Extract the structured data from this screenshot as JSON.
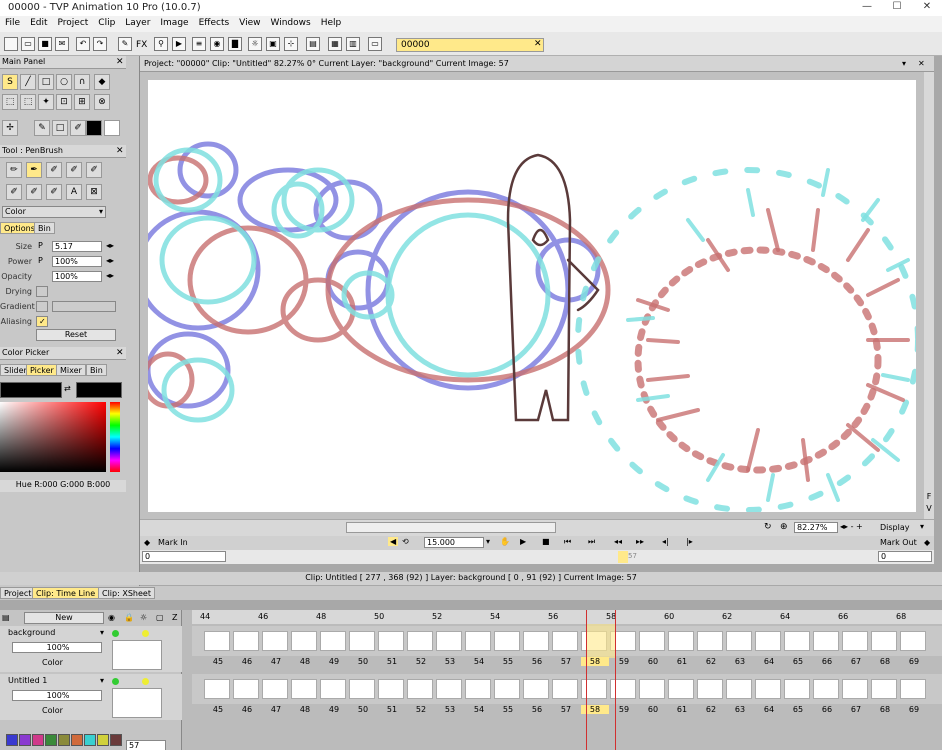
{
  "window": {
    "title": "00000 - TVP Animation 10 Pro (10.0.7)"
  },
  "menu": [
    "File",
    "Edit",
    "Project",
    "Clip",
    "Layer",
    "Image",
    "Effects",
    "View",
    "Windows",
    "Help"
  ],
  "toolbar": {
    "project_field": "00000",
    "fx_label": "FX"
  },
  "main_panel": {
    "title": "Main Panel"
  },
  "tool_panel": {
    "title": "Tool : PenBrush",
    "mode": "Color",
    "tabs": [
      "Options",
      "Bin"
    ],
    "size_label": "Size",
    "size_value": "5.17",
    "power_label": "Power",
    "power_value": "100%",
    "opacity_label": "Opacity",
    "opacity_value": "100%",
    "drying_label": "Drying",
    "gradient_label": "Gradient",
    "aliasing_label": "Aliasing",
    "reset_label": "Reset",
    "p_flag": "P"
  },
  "color_picker": {
    "title": "Color Picker",
    "tabs": [
      "Slider",
      "Picker",
      "Mixer",
      "Bin"
    ],
    "readout": "Hue R:000 G:000 B:000"
  },
  "canvas": {
    "header": "Project: \"00000\"  Clip: \"Untitled\"  82.27%  0°  Current Layer: \"background\"  Current Image: 57",
    "zoom": "82.27%",
    "display_label": "Display",
    "side_letters": [
      "F",
      "V"
    ]
  },
  "transport": {
    "mark_in": "Mark In",
    "mark_out": "Mark Out",
    "fps": "15.000",
    "mark_in_value": "0",
    "mark_out_value": "0",
    "current": "57"
  },
  "status": "Clip: Untitled [ 277 , 368  (92) ]       Layer: background [ 0 , 91  (92) ]    Current Image: 57",
  "bottom_tabs": [
    "Project",
    "Clip: Time Line",
    "Clip: XSheet"
  ],
  "timeline": {
    "new_label": "New",
    "z_label": "Z",
    "top_numbers": [
      "44",
      "46",
      "48",
      "50",
      "52",
      "54",
      "56",
      "58",
      "60",
      "62",
      "64",
      "66",
      "68"
    ],
    "frame_numbers": [
      "45",
      "46",
      "47",
      "48",
      "49",
      "50",
      "51",
      "52",
      "53",
      "54",
      "55",
      "56",
      "57",
      "58",
      "59",
      "60",
      "61",
      "62",
      "63",
      "64",
      "65",
      "66",
      "67",
      "68",
      "69"
    ],
    "layers": [
      {
        "name": "background",
        "opacity": "100%",
        "mode": "Color"
      },
      {
        "name": "Untitled 1",
        "opacity": "100%",
        "mode": "Color"
      }
    ],
    "bottom_field": "57"
  },
  "colors": {
    "accent": "#ffe98a",
    "red_stroke": "#c87070",
    "blue_stroke": "#8080e0",
    "cyan_stroke": "#80e0e0"
  }
}
